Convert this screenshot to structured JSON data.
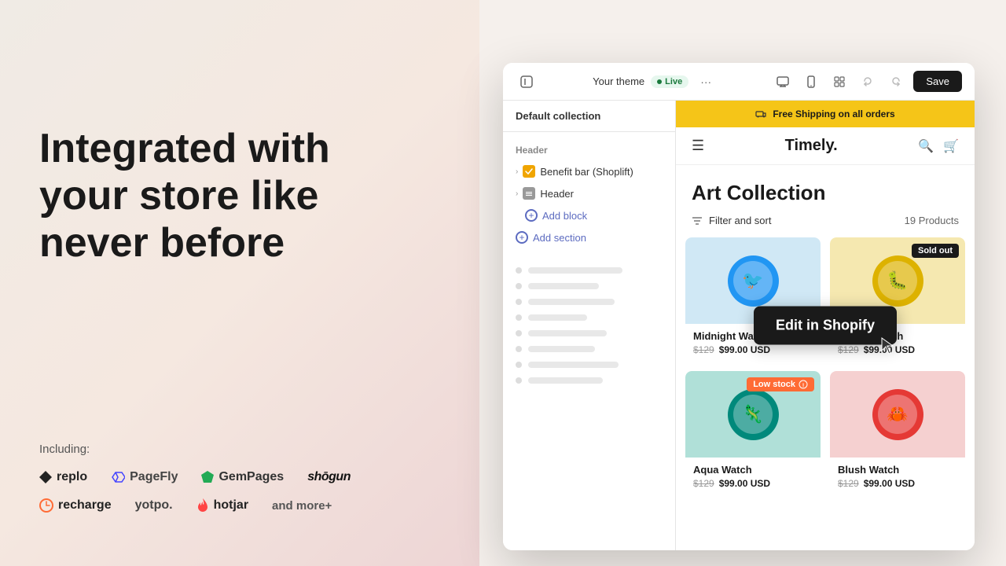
{
  "hero": {
    "title_line1": "Integrated with",
    "title_line2": "your store like",
    "title_line3": "never before"
  },
  "logos": {
    "label": "Including:",
    "row1": [
      {
        "name": "replo",
        "text": "replo",
        "icon": "◆"
      },
      {
        "name": "pagefly",
        "text": "PageFly",
        "icon": "❖"
      },
      {
        "name": "gempages",
        "text": "GemPages",
        "icon": "💎"
      },
      {
        "name": "shogun",
        "text": "shōgun",
        "icon": ""
      }
    ],
    "row2": [
      {
        "name": "recharge",
        "text": "recharge",
        "icon": "⟳"
      },
      {
        "name": "yotpo",
        "text": "yotpo.",
        "icon": ""
      },
      {
        "name": "hotjar",
        "text": "hotjar",
        "icon": "🔥"
      },
      {
        "name": "andmore",
        "text": "and more+",
        "icon": ""
      }
    ]
  },
  "editor": {
    "topbar": {
      "theme_label": "Your theme",
      "live_badge": "Live",
      "save_button": "Save",
      "dots_label": "···"
    },
    "sidebar": {
      "collection_title": "Default collection",
      "header_label": "Header",
      "benefit_bar": "Benefit bar (Shoplift)",
      "header_item": "Header",
      "add_block": "Add block",
      "add_section": "Add section"
    },
    "store": {
      "announcement": "Free Shipping on all orders",
      "logo": "Timely.",
      "collection_title": "Art Collection",
      "filter_label": "Filter and sort",
      "products_count": "19 Products",
      "products": [
        {
          "name": "Midnight Watch",
          "color": "blue",
          "bg": "blue",
          "original_price": "$129",
          "sale_price": "$99.00 USD",
          "badge": "",
          "character": "🐦"
        },
        {
          "name": "Amber Watch",
          "color": "yellow",
          "bg": "yellow",
          "original_price": "$129",
          "sale_price": "$99.00 USD",
          "badge": "Sold out",
          "character": "🐛"
        },
        {
          "name": "Aqua Watch",
          "color": "teal",
          "bg": "teal",
          "original_price": "$129",
          "sale_price": "$99.00 USD",
          "badge": "Low stock",
          "character": "🦎"
        },
        {
          "name": "Blush Watch",
          "color": "red",
          "bg": "pink",
          "original_price": "$129",
          "sale_price": "$99.00 USD",
          "badge": "",
          "character": "🦀"
        }
      ]
    },
    "edit_button": "Edit in Shopify"
  }
}
